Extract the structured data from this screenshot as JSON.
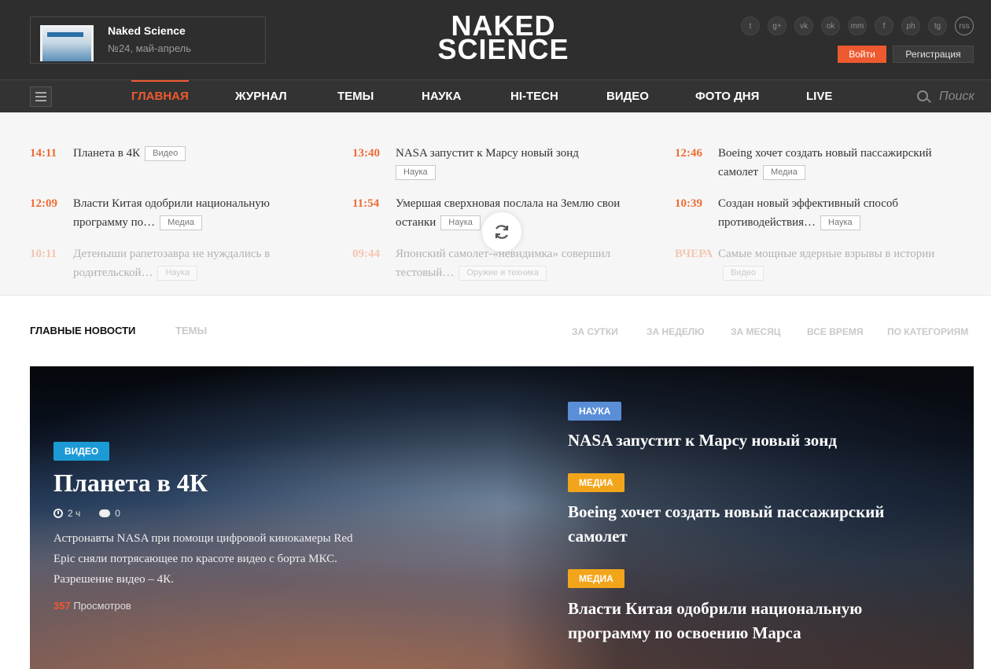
{
  "header": {
    "magazine": {
      "title": "Naked Science",
      "issue": "№24, май-апрель"
    },
    "logo": {
      "line1": "NAKED",
      "line2": "SCIENCE"
    },
    "socials": [
      "t",
      "g+",
      "vk",
      "ok",
      "mm",
      "f",
      "ph",
      "tg",
      "rss"
    ],
    "login_label": "Войти",
    "register_label": "Регистрация"
  },
  "nav": {
    "items": [
      "ГЛАВНАЯ",
      "ЖУРНАЛ",
      "ТЕМЫ",
      "НАУКА",
      "HI-TECH",
      "ВИДЕО",
      "ФОТО ДНЯ",
      "LIVE"
    ],
    "search_placeholder": "Поиск"
  },
  "ticker": [
    {
      "time": "14:11",
      "title": "Планета в 4К",
      "tag": "Видео"
    },
    {
      "time": "13:40",
      "title": "NASA запустит к Марсу новый зонд",
      "tag": "Наука"
    },
    {
      "time": "12:46",
      "title": "Boeing хочет создать новый пассажирский самолет",
      "tag": "Медиа"
    },
    {
      "time": "12:09",
      "title": "Власти Китая одобрили национальную программу по…",
      "tag": "Медиа"
    },
    {
      "time": "11:54",
      "title": "Умершая сверхновая послала на Землю свои останки",
      "tag": "Наука"
    },
    {
      "time": "10:39",
      "title": "Создан новый эффективный способ противодействия…",
      "tag": "Наука"
    },
    {
      "time": "10:11",
      "title": "Детеныши рапетозавра не нуждались в родительской…",
      "tag": "Наука"
    },
    {
      "time": "09:44",
      "title": "Японский самолет-«невидимка» совершил тестовый…",
      "tag": "Оружие и техника"
    },
    {
      "time": "ВЧЕРА",
      "title": "Самые мощные ядерные взрывы в истории",
      "tag": "Видео"
    }
  ],
  "tabs": {
    "main": "ГЛАВНЫЕ НОВОСТИ",
    "themes": "ТЕМЫ",
    "filters": [
      "ЗА СУТКИ",
      "ЗА НЕДЕЛЮ",
      "ЗА МЕСЯЦ",
      "ВСЕ ВРЕМЯ",
      "ПО КАТЕГОРИЯМ"
    ]
  },
  "hero": {
    "category": "ВИДЕО",
    "title": "Планета в 4К",
    "time_ago": "2 ч",
    "comments": "0",
    "description": "Астронавты NASA при помощи цифровой кинокамеры Red Epic сняли потрясающее по красоте видео с борта МКС. Разрешение видео – 4К.",
    "views_count": "357",
    "views_label": "Просмотров",
    "side": [
      {
        "category": "НАУКА",
        "title": "NASA запустит к Марсу новый зонд"
      },
      {
        "category": "МЕДИА",
        "title": "Boeing хочет создать новый пассажирский самолет"
      },
      {
        "category": "МЕДИА",
        "title": "Власти Китая одобрили национальную программу по освоению Марса"
      }
    ]
  },
  "colors": {
    "accent": "#ee5a2f",
    "video_badge": "#1b9ad6",
    "science_badge": "#5a8fd8",
    "media_badge": "#f2a51b"
  }
}
